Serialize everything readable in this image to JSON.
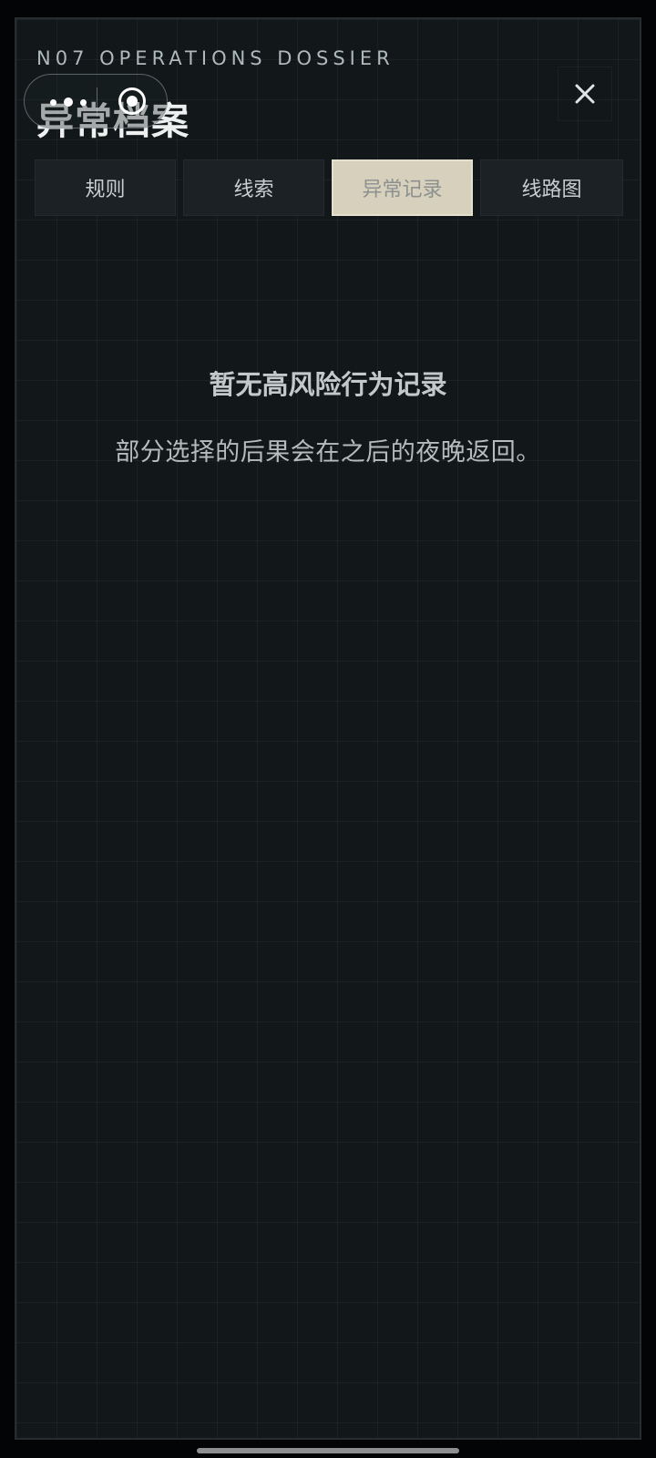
{
  "header": {
    "kicker": "N07 OPERATIONS DOSSIER",
    "title": "异常档案",
    "close_glyph": "✕"
  },
  "capsule": {
    "more_icon": "more-dots-icon",
    "target_icon": "target-icon"
  },
  "tabs": [
    {
      "label": "规则",
      "active": false
    },
    {
      "label": "线索",
      "active": false
    },
    {
      "label": "异常记录",
      "active": true
    },
    {
      "label": "线路图",
      "active": false
    }
  ],
  "empty_state": {
    "title": "暂无高风险行为记录",
    "description": "部分选择的后果会在之后的夜晚返回。"
  },
  "colors": {
    "background": "#121719",
    "active_tab": "#d7d0bc",
    "text": "#c3c9ca"
  }
}
